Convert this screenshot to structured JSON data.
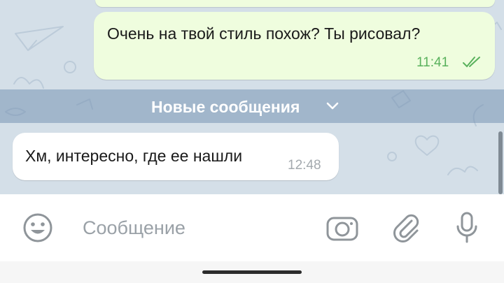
{
  "messages": [
    {
      "direction": "outgoing",
      "text": "Очень на твой стиль похож? Ты рисовал?",
      "time": "11:41",
      "status": "read"
    },
    {
      "direction": "incoming",
      "text": "Хм, интересно, где ее нашли",
      "time": "12:48"
    }
  ],
  "divider": {
    "label": "Новые сообщения"
  },
  "composer": {
    "placeholder": "Сообщение",
    "value": "",
    "icons": {
      "emoji": "smiley-face-icon",
      "camera": "camera-icon",
      "attach": "paperclip-icon",
      "voice": "microphone-icon"
    }
  },
  "colors": {
    "chat_background": "#d4dfe8",
    "outgoing_bubble": "#effdde",
    "incoming_bubble": "#ffffff",
    "outgoing_time": "#59b15c",
    "incoming_time": "#a3a9ae",
    "divider_band": "#8fa9c2",
    "icon_gray": "#8f959a"
  }
}
